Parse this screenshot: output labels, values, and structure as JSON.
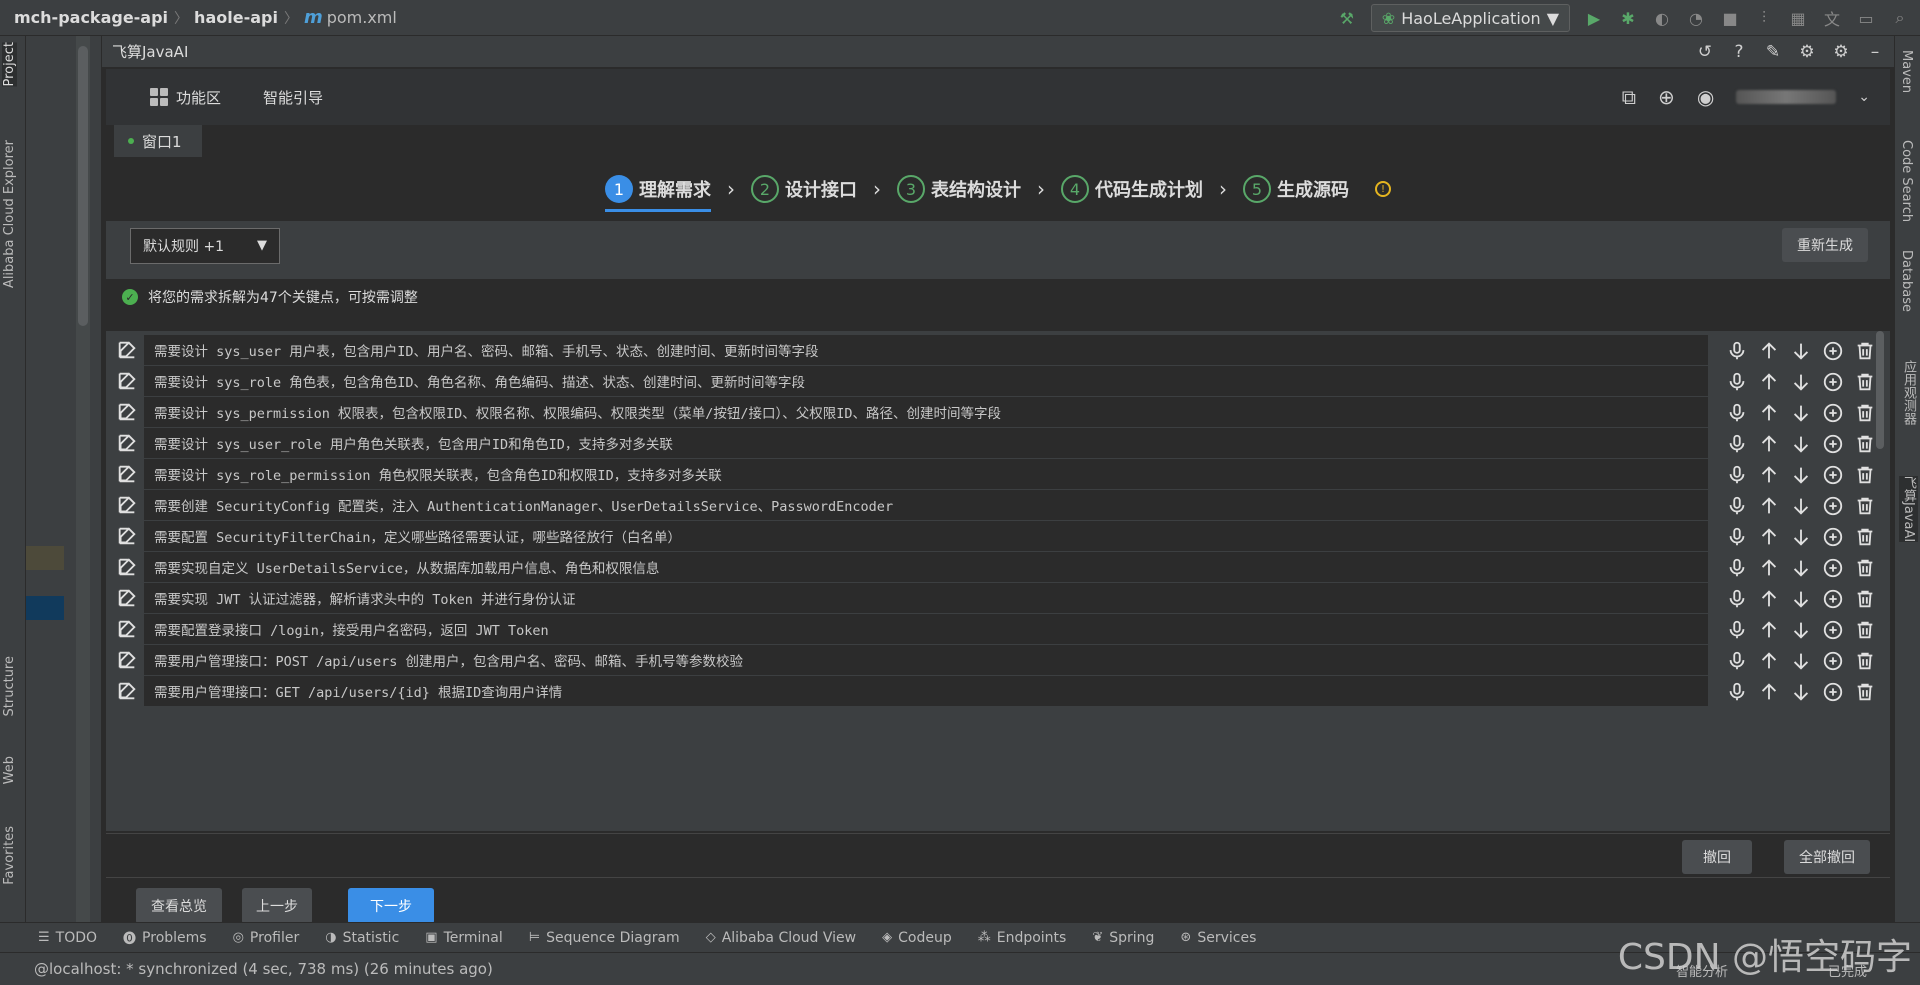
{
  "breadcrumb": {
    "project": "mch-package-api",
    "module": "haole-api",
    "file": "pom.xml"
  },
  "run_config": "HaoLeApplication",
  "left_strip": {
    "tabs": [
      "Project",
      "Alibaba Cloud Explorer",
      "Structure",
      "Web",
      "Favorites"
    ]
  },
  "right_strip": {
    "tabs": [
      "Maven",
      "Code Search",
      "Database",
      "应用观测器",
      "飞算JavaAI"
    ]
  },
  "plugin": {
    "title": "飞算JavaAI",
    "nav": {
      "features": "功能区",
      "guide": "智能引导"
    },
    "window_tab": "窗口1"
  },
  "steps": [
    {
      "num": "1",
      "label": "理解需求",
      "active": true
    },
    {
      "num": "2",
      "label": "设计接口",
      "active": false
    },
    {
      "num": "3",
      "label": "表结构设计",
      "active": false
    },
    {
      "num": "4",
      "label": "代码生成计划",
      "active": false
    },
    {
      "num": "5",
      "label": "生成源码",
      "active": false
    }
  ],
  "rules": {
    "selected": "默认规则 +1",
    "regenerate": "重新生成"
  },
  "summary": "将您的需求拆解为47个关键点，可按需调整",
  "requirements": [
    "需要设计 sys_user 用户表，包含用户ID、用户名、密码、邮箱、手机号、状态、创建时间、更新时间等字段",
    "需要设计 sys_role 角色表，包含角色ID、角色名称、角色编码、描述、状态、创建时间、更新时间等字段",
    "需要设计 sys_permission 权限表，包含权限ID、权限名称、权限编码、权限类型（菜单/按钮/接口）、父权限ID、路径、创建时间等字段",
    "需要设计 sys_user_role 用户角色关联表，包含用户ID和角色ID，支持多对多关联",
    "需要设计 sys_role_permission 角色权限关联表，包含角色ID和权限ID，支持多对多关联",
    "需要创建 SecurityConfig 配置类，注入 AuthenticationManager、UserDetailsService、PasswordEncoder",
    "需要配置 SecurityFilterChain，定义哪些路径需要认证，哪些路径放行（白名单）",
    "需要实现自定义 UserDetailsService，从数据库加载用户信息、角色和权限信息",
    "需要实现 JWT 认证过滤器，解析请求头中的 Token 并进行身份认证",
    "需要配置登录接口 /login，接受用户名密码，返回 JWT Token",
    "需要用户管理接口：POST /api/users 创建用户，包含用户名、密码、邮箱、手机号等参数校验",
    "需要用户管理接口：GET /api/users/{id} 根据ID查询用户详情"
  ],
  "actions": {
    "undo": "撤回",
    "undo_all": "全部撤回",
    "overview": "查看总览",
    "prev": "上一步",
    "next": "下一步"
  },
  "bottom_tools": [
    "TODO",
    "Problems",
    "Profiler",
    "Statistic",
    "Terminal",
    "Sequence Diagram",
    "Alibaba Cloud View",
    "Codeup",
    "Endpoints",
    "Spring",
    "Services"
  ],
  "status": "@localhost: * synchronized (4 sec, 738 ms) (26 minutes ago)",
  "status_right": {
    "analysis": "智能分析",
    "done": "已完成"
  },
  "watermark": "CSDN @悟空码字",
  "colors": {
    "accent": "#3a8ee6",
    "success": "#4caf50",
    "warning": "#e5b520"
  }
}
